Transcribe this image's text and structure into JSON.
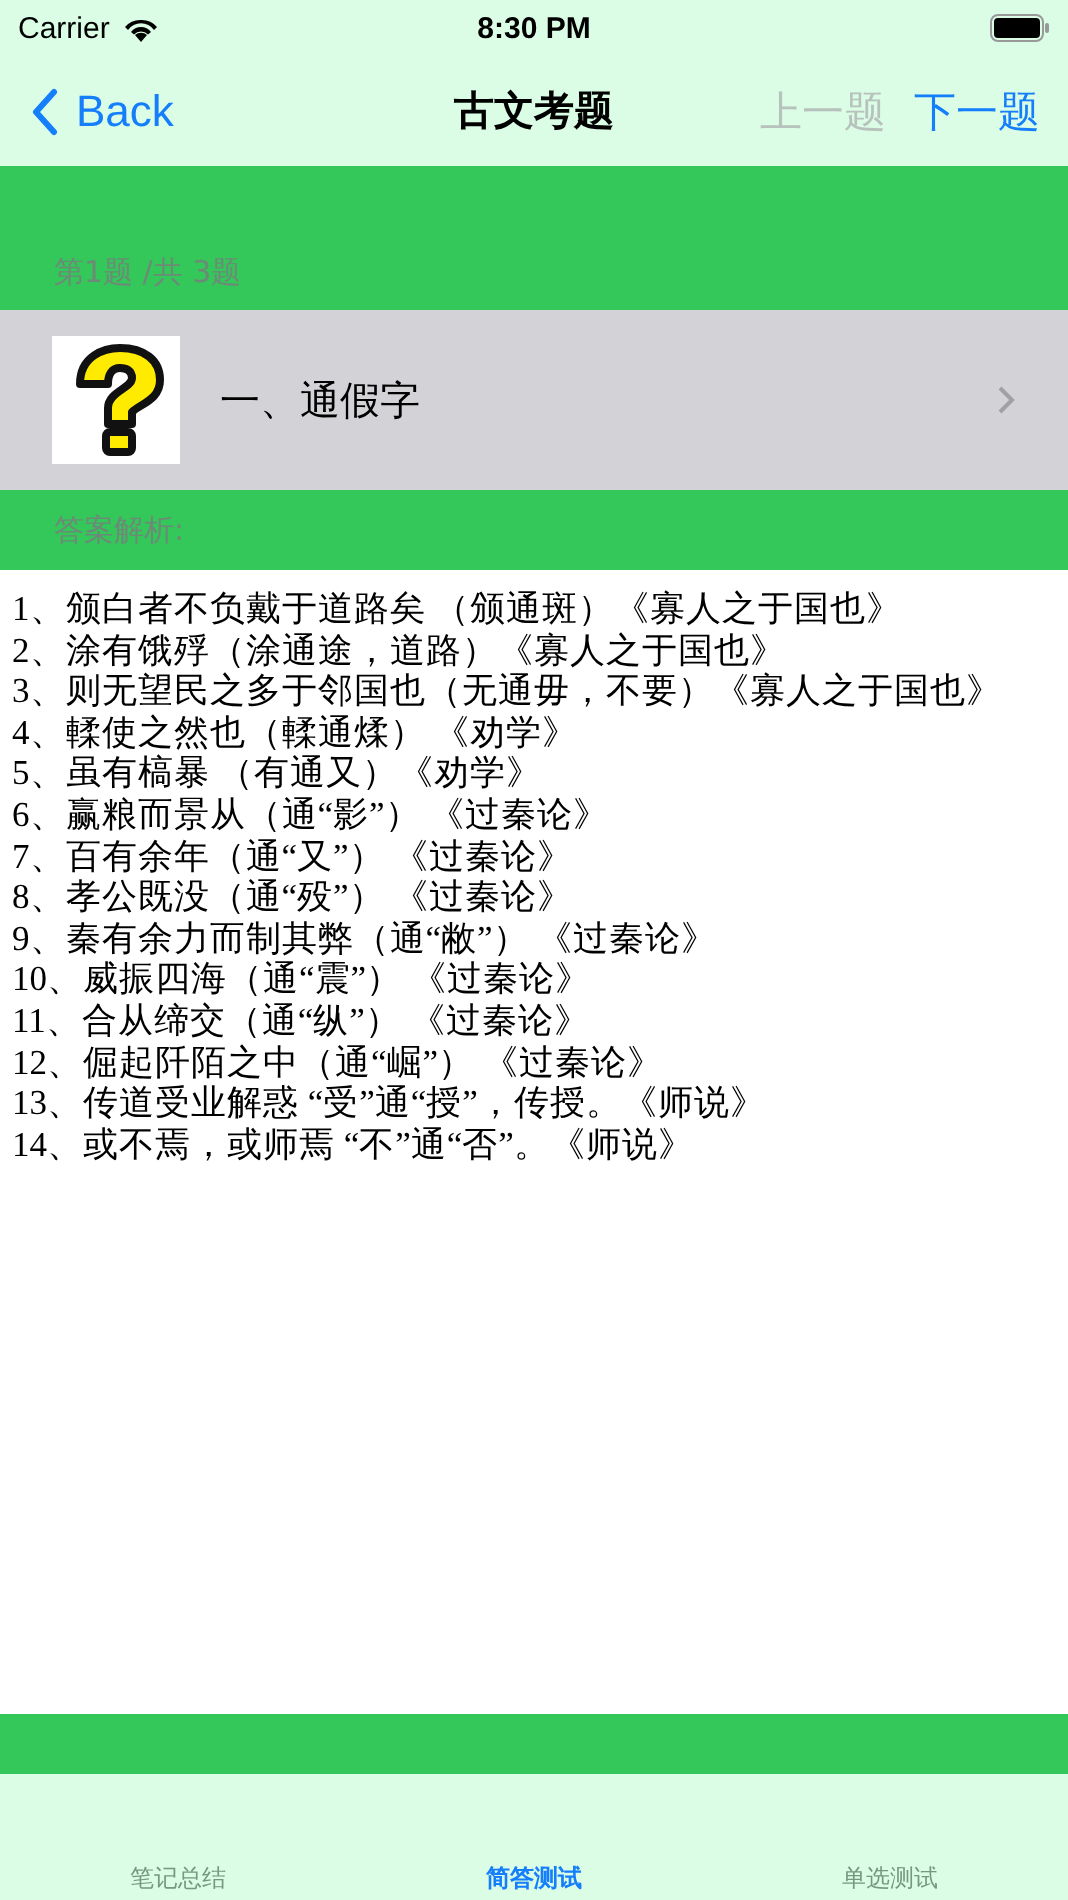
{
  "status_bar": {
    "carrier": "Carrier",
    "time": "8:30 PM"
  },
  "nav": {
    "back": "Back",
    "title": "古文考题",
    "prev": {
      "label": "上一题",
      "disabled": true
    },
    "next": {
      "label": "下一题",
      "disabled": false
    }
  },
  "counter": "第1题 /共 3题",
  "question": {
    "title": "一、通假字"
  },
  "answer_label": "答案解析:",
  "answer_lines": [
    "1、颁白者不负戴于道路矣 （颁通斑）《寡人之于国也》",
    "2、涂有饿殍（涂通途，道路）《寡人之于国也》",
    "3、则无望民之多于邻国也（无通毋，不要）《寡人之于国也》",
    "4、輮使之然也（輮通煣） 《劝学》",
    "5、虽有槁暴 （有通又）《劝学》",
    "6、赢粮而景从（通“影”） 《过秦论》",
    "7、百有余年（通“又”） 《过秦论》",
    "8、孝公既没（通“殁”） 《过秦论》",
    "9、秦有余力而制其弊（通“敝”） 《过秦论》",
    "10、威振四海（通“震”） 《过秦论》",
    "11、合从缔交（通“纵”） 《过秦论》",
    "12、倔起阡陌之中（通“崛”） 《过秦论》",
    "13、传道受业解惑 “受”通“授”，传授。《师说》",
    "14、或不焉，或师焉 “不”通“否”。《师说》"
  ],
  "tabs": [
    {
      "label": "笔记总结",
      "selected": false
    },
    {
      "label": "简答测试",
      "selected": true
    },
    {
      "label": "单选测试",
      "selected": false
    }
  ]
}
